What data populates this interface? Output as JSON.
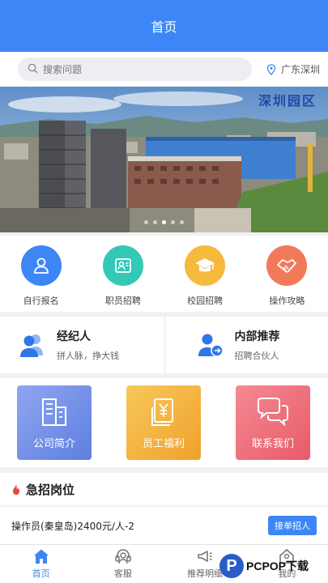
{
  "header": {
    "title": "首页"
  },
  "search": {
    "placeholder": "搜索问题",
    "icon": "search-icon"
  },
  "location": {
    "text": "广东深圳",
    "icon": "location-pin-icon"
  },
  "banner": {
    "title": "深圳园区",
    "slide_count": 5,
    "active_slide": 3
  },
  "quick_actions": [
    {
      "label": "自行报名",
      "icon": "user-icon",
      "color": "#3d86f5"
    },
    {
      "label": "职员招聘",
      "icon": "id-card-icon",
      "color": "#34c8b7"
    },
    {
      "label": "校园招聘",
      "icon": "graduation-cap-icon",
      "color": "#f5b93b"
    },
    {
      "label": "操作攻略",
      "icon": "handshake-icon",
      "color": "#f27a5a"
    }
  ],
  "referrals": [
    {
      "title": "经纪人",
      "subtitle": "拼人脉，挣大钱",
      "icon": "users-icon"
    },
    {
      "title": "内部推荐",
      "subtitle": "招聘合伙人",
      "icon": "user-share-icon"
    }
  ],
  "feature_cards": [
    {
      "label": "公司简介",
      "icon": "building-icon",
      "color": "#6f8fe8"
    },
    {
      "label": "员工福利",
      "icon": "yen-document-icon",
      "color": "#f5b240"
    },
    {
      "label": "联系我们",
      "icon": "chat-bubbles-icon",
      "color": "#ee6b7a"
    }
  ],
  "urgent": {
    "title": "急招岗位",
    "icon": "fire-icon",
    "accent": "#e5453b"
  },
  "jobs": [
    {
      "title": "操作员(秦皇岛)2400元/人-2",
      "button": "接单招人"
    }
  ],
  "tabbar": [
    {
      "label": "首页",
      "icon": "home-icon",
      "active": true
    },
    {
      "label": "客服",
      "icon": "headset-icon",
      "active": false
    },
    {
      "label": "推荐明细",
      "icon": "megaphone-icon",
      "active": false
    },
    {
      "label": "我的",
      "icon": "profile-icon",
      "active": false
    }
  ],
  "watermark": {
    "letter": "P",
    "text": "PCPOP下载"
  },
  "colors": {
    "primary": "#3d86f5",
    "background": "#f0f1f3"
  }
}
